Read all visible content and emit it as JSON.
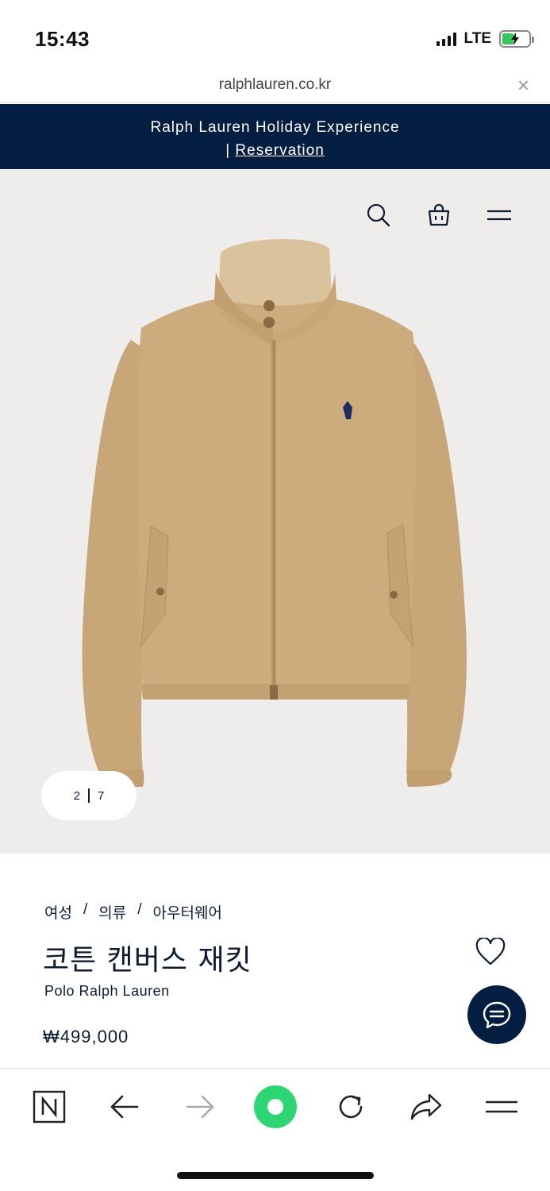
{
  "status_bar": {
    "time": "15:43",
    "network": "LTE"
  },
  "browser": {
    "url": "ralphlauren.co.kr",
    "close_glyph": "×"
  },
  "promo": {
    "title": "Ralph Lauren Holiday Experience",
    "separator": "|",
    "link_label": "Reservation"
  },
  "gallery": {
    "current_image": "2",
    "total_images": "7",
    "icons": [
      "search-icon",
      "shopping-bag-icon",
      "menu-icon"
    ],
    "background": "#efedeb"
  },
  "product": {
    "breadcrumb": [
      "여성",
      "의류",
      "아우터웨어"
    ],
    "breadcrumb_separator": "/",
    "name": "코튼 캔버스 재킷",
    "brand": "Polo Ralph Lauren",
    "price": "₩499,000"
  },
  "toolbar": {
    "items": [
      "naver-home-icon",
      "back-arrow-icon",
      "forward-arrow-icon",
      "green-dot-icon",
      "reload-icon",
      "share-icon",
      "menu-icon"
    ]
  },
  "colors": {
    "navy": "#041e42",
    "text": "#0d1b33",
    "jacket": "#c9a878",
    "green": "#2ed573"
  }
}
